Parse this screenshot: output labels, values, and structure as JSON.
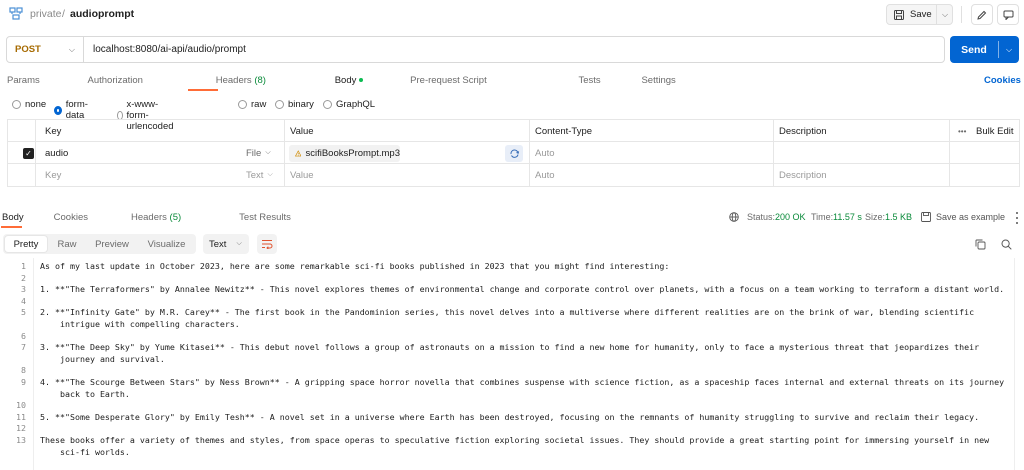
{
  "breadcrumb": {
    "workspace": "private",
    "separator": "/",
    "request_name": "audioprompt"
  },
  "toolbar": {
    "save_label": "Save"
  },
  "request": {
    "method": "POST",
    "url": "localhost:8080/ai-api/audio/prompt",
    "send_label": "Send"
  },
  "request_tabs": [
    {
      "label": "Params"
    },
    {
      "label": "Authorization"
    },
    {
      "label": "Headers",
      "count": "(8)"
    },
    {
      "label": "Body"
    },
    {
      "label": "Pre-request Script"
    },
    {
      "label": "Tests"
    },
    {
      "label": "Settings"
    }
  ],
  "cookies_link": "Cookies",
  "body_types": [
    "none",
    "form-data",
    "x-www-form-urlencoded",
    "raw",
    "binary",
    "GraphQL"
  ],
  "body_type_selected": "form-data",
  "form_table": {
    "headers": {
      "key": "Key",
      "value": "Value",
      "content_type": "Content-Type",
      "description": "Description",
      "bulk_edit": "Bulk Edit",
      "more": "•••"
    },
    "rows": [
      {
        "checked": true,
        "key": "audio",
        "type": "File",
        "value": "scifiBooksPrompt.mp3",
        "content_type": "Auto",
        "description": ""
      }
    ],
    "placeholder_row": {
      "key": "Key",
      "type": "Text",
      "value": "Value",
      "content_type": "Auto",
      "description": "Description"
    }
  },
  "response": {
    "tabs": [
      {
        "label": "Body"
      },
      {
        "label": "Cookies"
      },
      {
        "label": "Headers",
        "count": "(5)"
      },
      {
        "label": "Test Results"
      }
    ],
    "status_label": "Status:",
    "status_value": "200 OK",
    "time_label": "Time:",
    "time_value": "11.57 s",
    "size_label": "Size:",
    "size_value": "1.5 KB",
    "save_example": "Save as example",
    "view_modes": [
      "Pretty",
      "Raw",
      "Preview",
      "Visualize"
    ],
    "format": "Text",
    "lines": [
      {
        "n": "1",
        "text": "As of my last update in October 2023, here are some remarkable sci-fi books published in 2023 that you might find interesting:"
      },
      {
        "n": "2",
        "text": ""
      },
      {
        "n": "3",
        "text": "1. **\"The Terraformers\" by Annalee Newitz** - This novel explores themes of environmental change and corporate control over planets, with a focus on a team working to terraform a distant world."
      },
      {
        "n": "4",
        "text": ""
      },
      {
        "n": "5",
        "text": "2. **\"Infinity Gate\" by M.R. Carey** - The first book in the Pandominion series, this novel delves into a multiverse where different realities are on the brink of war, blending scientific"
      },
      {
        "n": "",
        "text": "    intrigue with compelling characters."
      },
      {
        "n": "6",
        "text": ""
      },
      {
        "n": "7",
        "text": "3. **\"The Deep Sky\" by Yume Kitasei** - This debut novel follows a group of astronauts on a mission to find a new home for humanity, only to face a mysterious threat that jeopardizes their"
      },
      {
        "n": "",
        "text": "    journey and survival."
      },
      {
        "n": "8",
        "text": ""
      },
      {
        "n": "9",
        "text": "4. **\"The Scourge Between Stars\" by Ness Brown** - A gripping space horror novella that combines suspense with science fiction, as a spaceship faces internal and external threats on its journey"
      },
      {
        "n": "",
        "text": "    back to Earth."
      },
      {
        "n": "10",
        "text": ""
      },
      {
        "n": "11",
        "text": "5. **\"Some Desperate Glory\" by Emily Tesh** - A novel set in a universe where Earth has been destroyed, focusing on the remnants of humanity struggling to survive and reclaim their legacy."
      },
      {
        "n": "12",
        "text": ""
      },
      {
        "n": "13",
        "text": "These books offer a variety of themes and styles, from space operas to speculative fiction exploring societal issues. They should provide a great starting point for immersing yourself in new"
      },
      {
        "n": "",
        "text": "    sci-fi worlds."
      }
    ]
  },
  "colors": {
    "accent_send": "#0265d2",
    "method_post": "#a66a00",
    "status_ok": "#0a8a3a",
    "active_tab_underline": "#ff6c37",
    "selected_radio": "#0265d2"
  },
  "icons": [
    "collection-icon",
    "save-icon",
    "edit-pencil-icon",
    "comment-icon",
    "globe-icon",
    "file-warning-icon",
    "refresh-icon",
    "copy-icon",
    "search-icon",
    "wrap-lines-icon",
    "more-vertical-icon"
  ]
}
